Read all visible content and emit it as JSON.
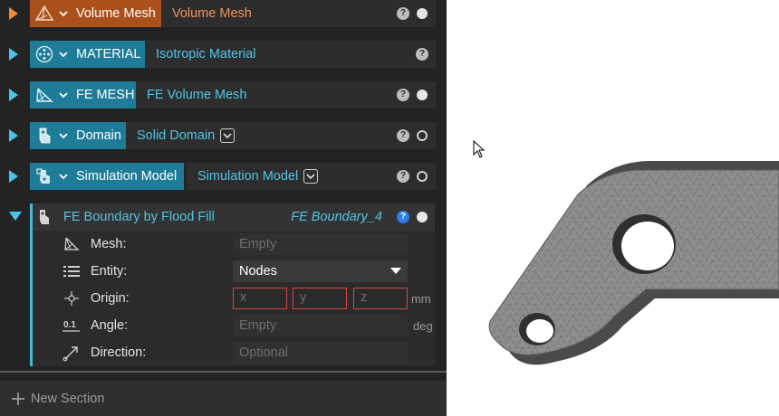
{
  "colors": {
    "orange": "#a9501b",
    "orange_text": "#f3925c",
    "teal": "#1e7c99",
    "teal_text": "#52c4e6",
    "accent_arrow": "#4cc3e8",
    "orange_arrow": "#ee8a3c",
    "error_border": "#d64545",
    "help_blue": "#2b7de9"
  },
  "sections": [
    {
      "type_label": "Volume Mesh",
      "value": "Volume Mesh",
      "icon": "mesh-pyramid-icon",
      "help": "?",
      "status": "filled"
    },
    {
      "type_label": "MATERIAL",
      "value": "Isotropic Material",
      "icon": "material-dots-icon",
      "help": "?",
      "status": "none"
    },
    {
      "type_label": "FE MESH",
      "value": "FE Volume Mesh",
      "icon": "fe-mesh-icon",
      "help": "?",
      "status": "filled"
    },
    {
      "type_label": "Domain",
      "value": "Solid Domain",
      "icon": "domain-part-icon",
      "help": "?",
      "status": "hollow"
    },
    {
      "type_label": "Simulation Model",
      "value": "Simulation Model",
      "icon": "simulation-model-icon",
      "help": "?",
      "status": "hollow"
    }
  ],
  "expanded": {
    "title": "FE Boundary by Flood Fill",
    "value": "FE Boundary_4",
    "help": "?",
    "properties": {
      "mesh": {
        "label": "Mesh:",
        "placeholder": "Empty"
      },
      "entity": {
        "label": "Entity:",
        "value": "Nodes"
      },
      "origin": {
        "label": "Origin:",
        "x": "x",
        "y": "y",
        "z": "z",
        "unit": "mm"
      },
      "angle": {
        "label": "Angle:",
        "placeholder": "Empty",
        "unit": "deg"
      },
      "direction": {
        "label": "Direction:",
        "placeholder": "Optional"
      }
    }
  },
  "new_section_label": "New Section"
}
